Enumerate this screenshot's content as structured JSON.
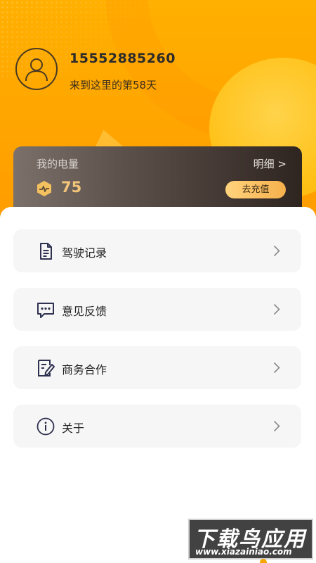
{
  "profile": {
    "phone": "15552885260",
    "days_text": "来到这里的第58天"
  },
  "energy": {
    "title": "我的电量",
    "detail_label": "明细 >",
    "value": "75",
    "recharge_label": "去充值"
  },
  "menu": {
    "items": [
      {
        "label": "驾驶记录",
        "icon": "document-icon"
      },
      {
        "label": "意见反馈",
        "icon": "chat-bubble-icon"
      },
      {
        "label": "商务合作",
        "icon": "edit-note-icon"
      },
      {
        "label": "关于",
        "icon": "info-icon"
      }
    ]
  },
  "watermark": {
    "main": "下载鸟应用",
    "sub": "www.xiazainiao.com"
  },
  "colors": {
    "header_orange": "#ffa400",
    "accent_gold": "#f3c57a",
    "menu_bg": "#f6f6f6",
    "icon_navy": "#2f3150"
  }
}
